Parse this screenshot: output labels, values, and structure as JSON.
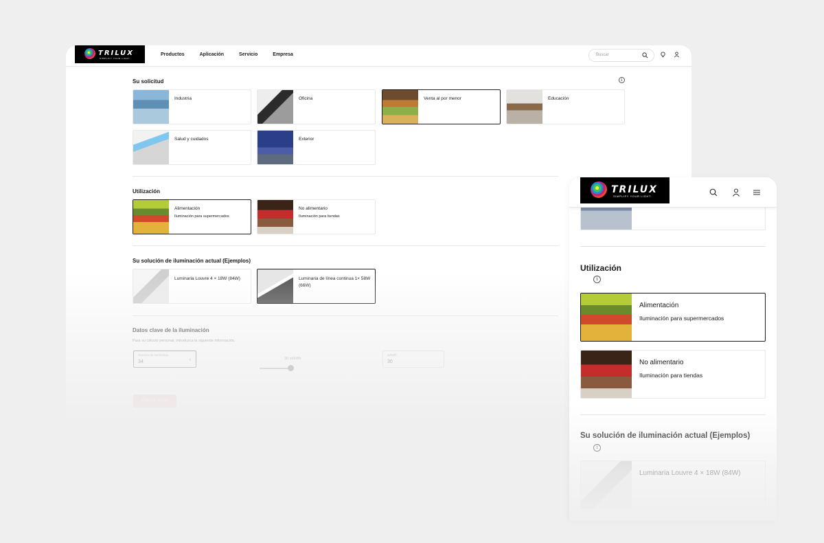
{
  "brand": {
    "name": "TRILUX",
    "tagline": "SIMPLIFY YOUR LIGHT."
  },
  "desktop": {
    "nav": [
      "Productos",
      "Aplicación",
      "Servicio",
      "Empresa"
    ],
    "search_placeholder": "Buscar",
    "solicitud": {
      "title": "Su solicitud",
      "cards": [
        "Industria",
        "Oficina",
        "Venta al por menor",
        "Educación",
        "Salud y cuidados",
        "Exterior"
      ],
      "selected": "Venta al por menor"
    },
    "utilizacion": {
      "title": "Utilización",
      "cards": [
        {
          "title": "Alimentación",
          "subtitle": "Iluminación para supermercados",
          "selected": true
        },
        {
          "title": "No alimentario",
          "subtitle": "Iluminación para tiendas",
          "selected": false
        }
      ]
    },
    "solucion": {
      "title": "Su solución de iluminación actual (Ejemplos)",
      "cards": [
        {
          "title": "Luminaria Louvre 4 × 18W (84W)",
          "selected": false
        },
        {
          "title": "Luminaria de línea continua 1× 58W (66W)",
          "selected": true
        }
      ]
    },
    "datos": {
      "title": "Datos clave de la iluminación",
      "subtitle": "Para su cálculo personal, introduzca la siguiente información.",
      "luminarias_label": "Número de luminarias",
      "luminarias_value": "34",
      "slider_label": "30 ct/kWh",
      "slider_fraction": 0.9,
      "field3_label": "ct/kWh",
      "field3_value": "30",
      "button": "Calcular ahora"
    }
  },
  "mobile": {
    "utilizacion": {
      "title": "Utilización",
      "cards": [
        {
          "title": "Alimentación",
          "subtitle": "Iluminación para supermercados",
          "selected": true
        },
        {
          "title": "No alimentario",
          "subtitle": "Iluminación para tiendas",
          "selected": false
        }
      ]
    },
    "solucion": {
      "title": "Su solución de iluminación actual (Ejemplos)",
      "card": "Luminaria Louvre 4 × 18W (84W)"
    }
  }
}
